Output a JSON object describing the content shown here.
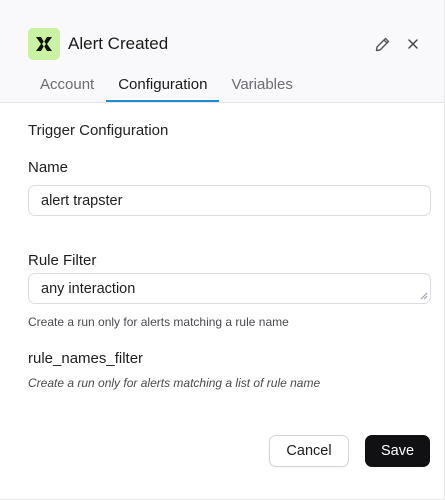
{
  "header": {
    "app_logo_icon": "zapier-style-x-logo-icon",
    "logo_bg_color": "#c9f2a2",
    "title": "Alert Created",
    "edit_icon": "pencil-icon",
    "close_icon": "close-icon"
  },
  "tabs": [
    {
      "label": "Account",
      "active": false
    },
    {
      "label": "Configuration",
      "active": true
    },
    {
      "label": "Variables",
      "active": false
    }
  ],
  "accent_color": "#1f8ad2",
  "section_title": "Trigger Configuration",
  "fields": {
    "name": {
      "label": "Name",
      "value": "alert trapster"
    },
    "rule_filter": {
      "label": "Rule Filter",
      "value": "any interaction",
      "help": "Create a run only for alerts matching a rule name"
    },
    "rule_names_filter": {
      "label": "rule_names_filter",
      "help": "Create a run only for alerts matching a list of rule name"
    }
  },
  "actions": {
    "cancel_label": "Cancel",
    "save_label": "Save"
  }
}
